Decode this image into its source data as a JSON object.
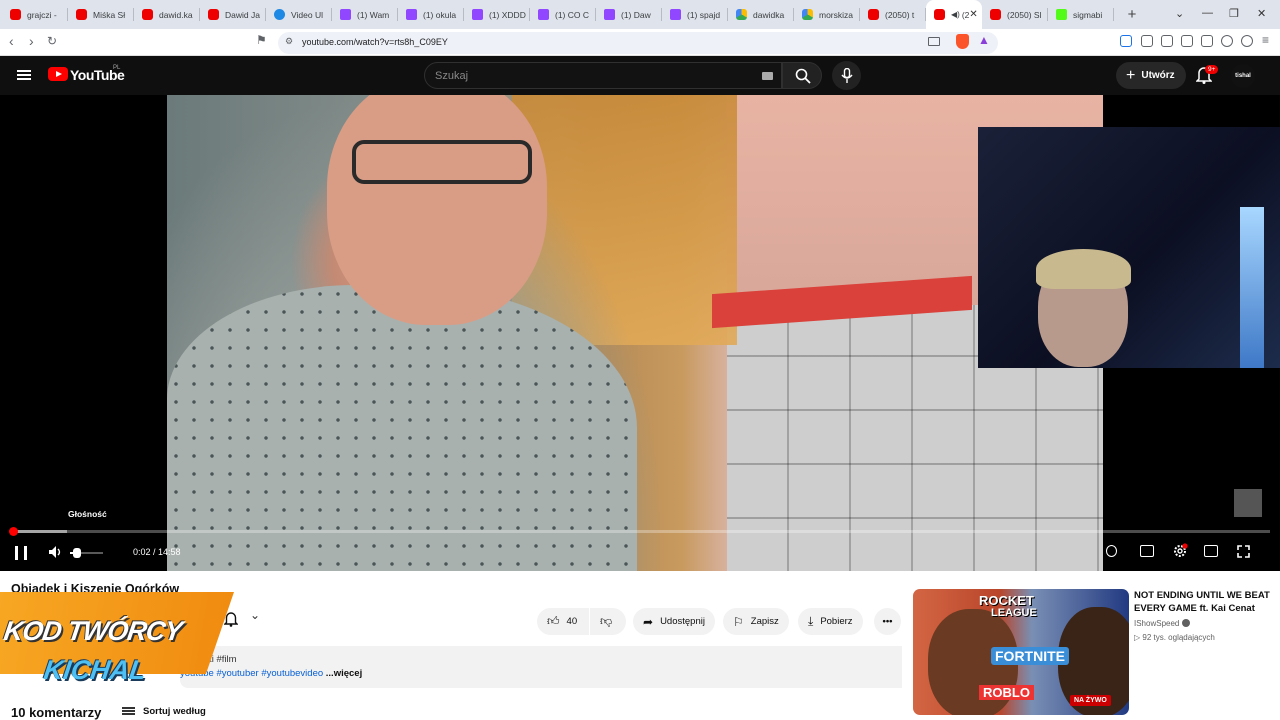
{
  "browser": {
    "tabs": [
      {
        "label": "grajczi -",
        "icon": "youtube-icon"
      },
      {
        "label": "Miśka Sł",
        "icon": "youtube-icon"
      },
      {
        "label": "dawid.ka",
        "icon": "youtube-icon"
      },
      {
        "label": "Dawid Ja",
        "icon": "youtube-icon"
      },
      {
        "label": "Video Ul",
        "icon": "video-icon"
      },
      {
        "label": "(1) Wam",
        "icon": "twitch-icon"
      },
      {
        "label": "(1) okula",
        "icon": "twitch-icon"
      },
      {
        "label": "(1) XDDD",
        "icon": "twitch-icon"
      },
      {
        "label": "(1) CO C",
        "icon": "twitch-icon"
      },
      {
        "label": "(1) Daw",
        "icon": "twitch-icon"
      },
      {
        "label": "(1) spajd",
        "icon": "twitch-icon"
      },
      {
        "label": "dawidka",
        "icon": "drive-icon"
      },
      {
        "label": "morskiza",
        "icon": "drive-icon"
      },
      {
        "label": "(2050) t",
        "icon": "youtube-icon"
      },
      {
        "label": "(2",
        "icon": "youtube-icon"
      },
      {
        "label": "(2050) Sl",
        "icon": "youtube-icon"
      },
      {
        "label": "sigmabi",
        "icon": "kick-icon"
      }
    ],
    "url": "youtube.com/watch?v=rts8h_C09EY"
  },
  "youtube": {
    "logo_text": "YouTube",
    "logo_region": "PL",
    "search_placeholder": "Szukaj",
    "create_label": "Utwórz",
    "notification_count": "9+",
    "avatar_text": "tishal"
  },
  "player": {
    "tooltip": "Głośność",
    "current_time": "0:02",
    "duration": "14:58",
    "time_display": "0:02 / 14:58",
    "progress_fraction": 0.002,
    "buffered_fraction": 0.045,
    "volume_fraction": 0.2
  },
  "video": {
    "title": "Obiadek i Kiszenie Ogórków",
    "like_count": "40",
    "share_label": "Udostępnij",
    "save_label": "Zapisz",
    "download_label": "Pobierz",
    "desc_line1": "ogórki #film",
    "desc_line2": "youtube #youtuber #youtubevideo",
    "desc_more": " ...więcej",
    "comments_label": "10 komentarzy",
    "sort_label": "Sortuj według"
  },
  "promo": {
    "line1": "KOD TWÓRCY",
    "line2": "KICHAL"
  },
  "recommendation": {
    "title": "NOT ENDING UNTIL WE BEAT EVERY GAME ft. Kai Cenat",
    "channel": "IShowSpeed",
    "views": "92 tys. oglądających",
    "live_badge": "NA ŻYWO",
    "thumb_text_1": "ROCKET",
    "thumb_text_2": "LEAGUE",
    "thumb_text_3": "FORTNITE",
    "thumb_text_4": "ROBLO"
  },
  "colors": {
    "youtube_red": "#ff0000",
    "promo_orange": "#f7a723",
    "promo_blue": "#4ec0f4",
    "link_blue": "#065fd4"
  }
}
